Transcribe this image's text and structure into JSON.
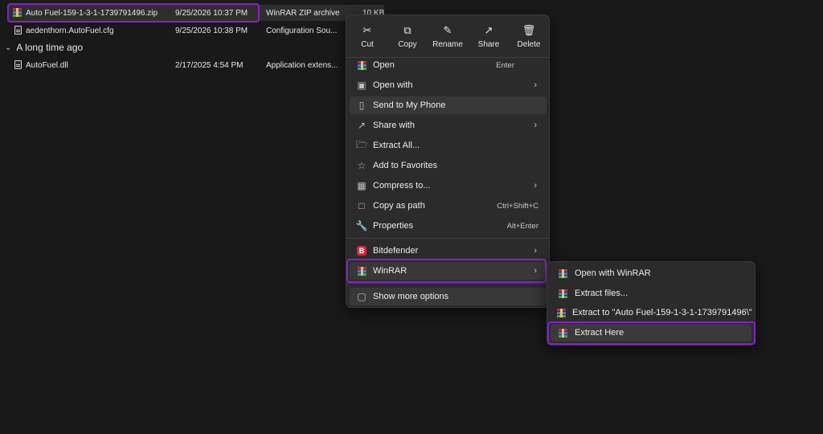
{
  "files": [
    {
      "name": "Auto Fuel-159-1-3-1-1739791496.zip",
      "date": "9/25/2026 10:37 PM",
      "type": "WinRAR ZIP archive",
      "size": "10 KB",
      "icon": "winrar-archive-icon"
    },
    {
      "name": "aedenthorn.AutoFuel.cfg",
      "date": "9/25/2026 10:38 PM",
      "type": "Configuration Sou...",
      "size": "",
      "icon": "config-file-icon"
    }
  ],
  "group": {
    "label": "A long time ago"
  },
  "old_files": [
    {
      "name": "AutoFuel.dll",
      "date": "2/17/2025 4:54 PM",
      "type": "Application extens...",
      "icon": "dll-file-icon"
    }
  ],
  "quick_actions": [
    {
      "label": "Cut",
      "icon": "scissors-icon"
    },
    {
      "label": "Copy",
      "icon": "copy-icon"
    },
    {
      "label": "Rename",
      "icon": "rename-icon"
    },
    {
      "label": "Share",
      "icon": "share-icon"
    },
    {
      "label": "Delete",
      "icon": "trash-icon"
    }
  ],
  "menu": {
    "open": {
      "label": "Open",
      "shortcut": "Enter"
    },
    "open_with": {
      "label": "Open with"
    },
    "send_to_phone": {
      "label": "Send to My Phone"
    },
    "share_with": {
      "label": "Share with"
    },
    "extract_all": {
      "label": "Extract All..."
    },
    "add_favorites": {
      "label": "Add to Favorites"
    },
    "compress_to": {
      "label": "Compress to..."
    },
    "copy_as_path": {
      "label": "Copy as path",
      "shortcut": "Ctrl+Shift+C"
    },
    "properties": {
      "label": "Properties",
      "shortcut": "Alt+Enter"
    },
    "bitdefender": {
      "label": "Bitdefender",
      "badge": "B"
    },
    "winrar": {
      "label": "WinRAR"
    },
    "show_more": {
      "label": "Show more options"
    }
  },
  "submenu": {
    "open_with_winrar": {
      "label": "Open with WinRAR"
    },
    "extract_files": {
      "label": "Extract files..."
    },
    "extract_to": {
      "label": "Extract to \"Auto Fuel-159-1-3-1-1739791496\\\""
    },
    "extract_here": {
      "label": "Extract Here"
    }
  },
  "colors": {
    "highlight": "#8a1fd0",
    "background": "#191919",
    "menu_bg": "#2b2b2b"
  }
}
